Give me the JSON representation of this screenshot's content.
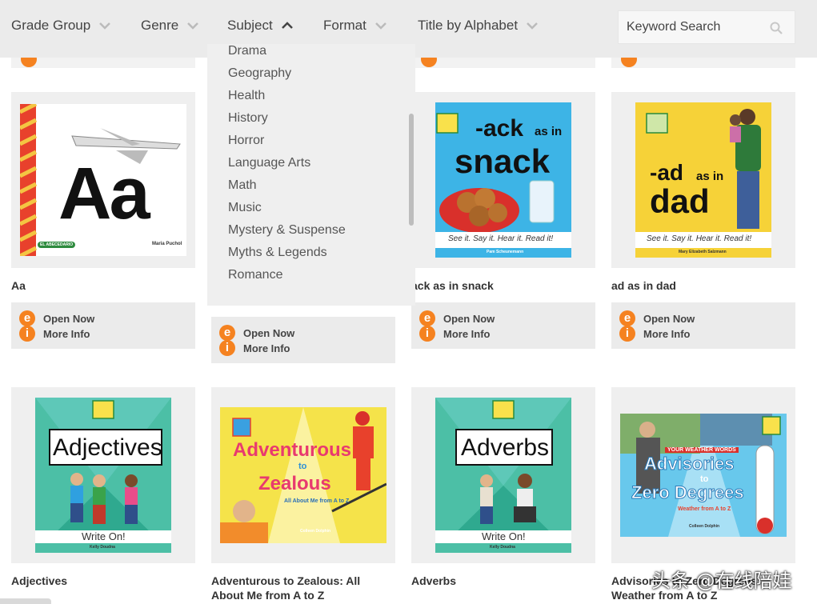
{
  "filters": {
    "grade_group": "Grade Group",
    "genre": "Genre",
    "subject": "Subject",
    "format": "Format",
    "title_by_alphabet": "Title by Alphabet"
  },
  "search": {
    "placeholder": "Keyword Search"
  },
  "subject_dropdown": {
    "items": [
      "Drama",
      "Geography",
      "Health",
      "History",
      "Horror",
      "Language Arts",
      "Math",
      "Music",
      "Mystery & Suspense",
      "Myths & Legends",
      "Romance"
    ]
  },
  "actions": {
    "open_now": "Open Now",
    "more_info": "More Info"
  },
  "icons": {
    "open": "e",
    "info": "i"
  },
  "cards": [
    {
      "title": "Aa",
      "cover_big": "Aa",
      "cover_small": "Maria Puchol",
      "cover_badge": "EL ABECEDARIO"
    },
    {
      "title": "ack as in snack",
      "cover_line1": "-ack",
      "cover_as": "as in",
      "cover_word": "snack",
      "cover_tag": "See it. Say it. Hear it. Read it!",
      "cover_author": "Pam Scheunemann"
    },
    {
      "title": "ad as in dad",
      "cover_line1": "-ad",
      "cover_as": "as in",
      "cover_word": "dad",
      "cover_tag": "See it. Say it. Hear it. Read it!",
      "cover_author": "Mary Elizabeth Salzmann"
    },
    {
      "title": "Adjectives",
      "cover_word": "Adjectives",
      "cover_tag": "Write On!",
      "cover_author": "Kelly Doudna"
    },
    {
      "title1": "Adventurous to Zealous: All",
      "title2": "About Me from A to Z",
      "cover_w1": "Adventurous",
      "cover_to": "to",
      "cover_w2": "Zealous",
      "cover_sub": "All About Me from A to Z",
      "cover_author": "Colleen Dolphin"
    },
    {
      "title": "Adverbs",
      "cover_word": "Adverbs",
      "cover_tag": "Write On!",
      "cover_author": "Kelly Doudna"
    },
    {
      "title1": "Advisories to Zero Degrees:",
      "title2": "Weather from A to Z",
      "cover_top": "YOUR WEATHER WORDS",
      "cover_w1": "Advisories",
      "cover_to": "to",
      "cover_w2": "Zero Degrees",
      "cover_sub": "Weather from A to Z",
      "cover_author": "Colleen Dolphin"
    }
  ],
  "watermark": "头条 @在线陪娃",
  "colors": {
    "accent": "#f58220",
    "bar": "#ebebeb",
    "frame": "#efefef"
  }
}
